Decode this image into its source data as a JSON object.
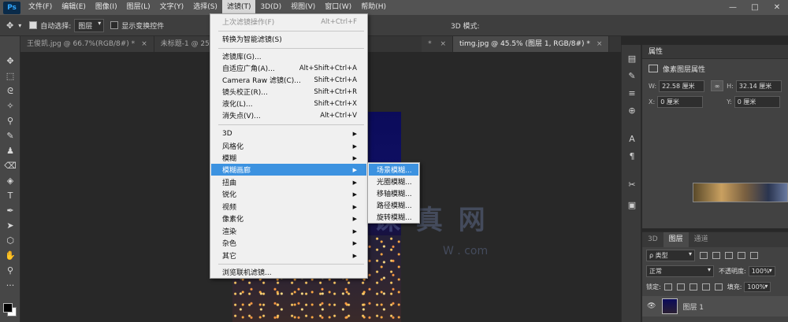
{
  "app": {
    "logo_text": "Ps"
  },
  "menubar": {
    "items": [
      "文件(F)",
      "编辑(E)",
      "图像(I)",
      "图层(L)",
      "文字(Y)",
      "选择(S)",
      "滤镜(T)",
      "3D(D)",
      "视图(V)",
      "窗口(W)",
      "帮助(H)"
    ],
    "active_index": 6
  },
  "window_controls": {
    "minimize": "—",
    "maximize": "□",
    "close": "✕"
  },
  "options": {
    "auto_select_label": "自动选择:",
    "auto_select_checked": true,
    "auto_select_value": "图层",
    "show_transform_label": "显示变换控件",
    "mode_3d_label": "3D 模式:"
  },
  "doc_tabs": [
    {
      "label": "王俊凯.jpg @ 66.7%(RGB/8#) *",
      "active": false
    },
    {
      "label": "未标题-1 @ 25%(RGB/8#) *",
      "active": false
    },
    {
      "label": "* ",
      "active": false
    },
    {
      "label": "timg.jpg @ 45.5% (图层 1, RGB/8#) *",
      "active": true
    }
  ],
  "filter_menu": {
    "last_filter": {
      "label": "上次滤镜操作(F)",
      "shortcut": "Alt+Ctrl+F"
    },
    "convert_smart": {
      "label": "转换为智能滤镜(S)"
    },
    "filter_gallery": {
      "label": "滤镜库(G)..."
    },
    "adaptive_wide": {
      "label": "自适应广角(A)...",
      "shortcut": "Alt+Shift+Ctrl+A"
    },
    "camera_raw": {
      "label": "Camera Raw 滤镜(C)...",
      "shortcut": "Shift+Ctrl+A"
    },
    "lens_correction": {
      "label": "镜头校正(R)...",
      "shortcut": "Shift+Ctrl+R"
    },
    "liquify": {
      "label": "液化(L)...",
      "shortcut": "Shift+Ctrl+X"
    },
    "vanishing_point": {
      "label": "消失点(V)...",
      "shortcut": "Alt+Ctrl+V"
    },
    "submenus": [
      "3D",
      "风格化",
      "模糊",
      "模糊画廊",
      "扭曲",
      "锐化",
      "视频",
      "像素化",
      "渲染",
      "杂色",
      "其它"
    ],
    "highlighted_submenu": "模糊画廊",
    "browse_online": {
      "label": "浏览联机滤镜..."
    }
  },
  "blur_gallery_menu": {
    "items": [
      "场景模糊...",
      "光圈模糊...",
      "移轴模糊...",
      "路径模糊...",
      "旋转模糊..."
    ],
    "highlighted_index": 0
  },
  "canvas": {
    "watermark": "课 真 网",
    "watermark_sub": "W . com"
  },
  "properties": {
    "title": "属性",
    "subtitle": "像素图层属性",
    "w_label": "W:",
    "w_value": "22.58 厘米",
    "h_label": "H:",
    "h_value": "32.14 厘米",
    "x_label": "X:",
    "x_value": "0 厘米",
    "y_label": "Y:",
    "y_value": "0 厘米",
    "link_glyph": "∞"
  },
  "layers": {
    "tabs": [
      "3D",
      "图层",
      "通道"
    ],
    "active_tab_index": 1,
    "filter_kind": "ρ 类型",
    "blend_mode": "正常",
    "opacity_label": "不透明度:",
    "opacity_value": "100%",
    "lock_label": "锁定:",
    "fill_label": "填充:",
    "fill_value": "100%",
    "layer_name": "图层 1"
  }
}
